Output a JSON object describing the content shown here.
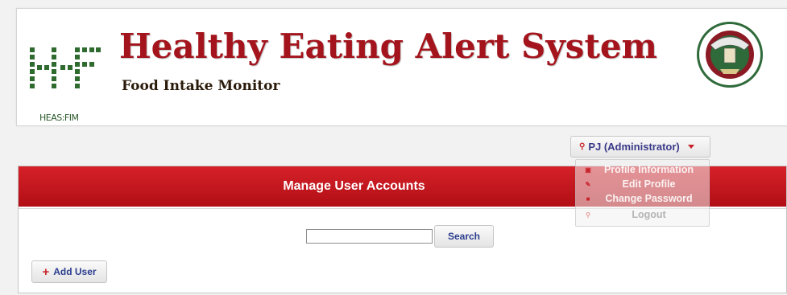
{
  "header": {
    "logo_caption": "HEAS:FIM",
    "title": "Healthy Eating Alert System",
    "subtitle": "Food Intake Monitor",
    "seal_icon": "university-seal-icon"
  },
  "user_menu": {
    "label": "PJ (Administrator)",
    "icon": "user-icon",
    "items": [
      {
        "label": "Profile Information",
        "icon": "document-icon"
      },
      {
        "label": "Edit Profile",
        "icon": "pencil-icon"
      },
      {
        "label": "Change Password",
        "icon": "lock-icon"
      },
      {
        "label": "Logout",
        "icon": "key-icon"
      }
    ]
  },
  "panel": {
    "title": "Manage User Accounts",
    "search": {
      "value": "",
      "placeholder": "",
      "button_label": "Search"
    },
    "add_user_label": "Add User"
  },
  "colors": {
    "accent_red": "#c8232b",
    "title_red": "#a4141c",
    "link_blue": "#2c3e8f"
  }
}
